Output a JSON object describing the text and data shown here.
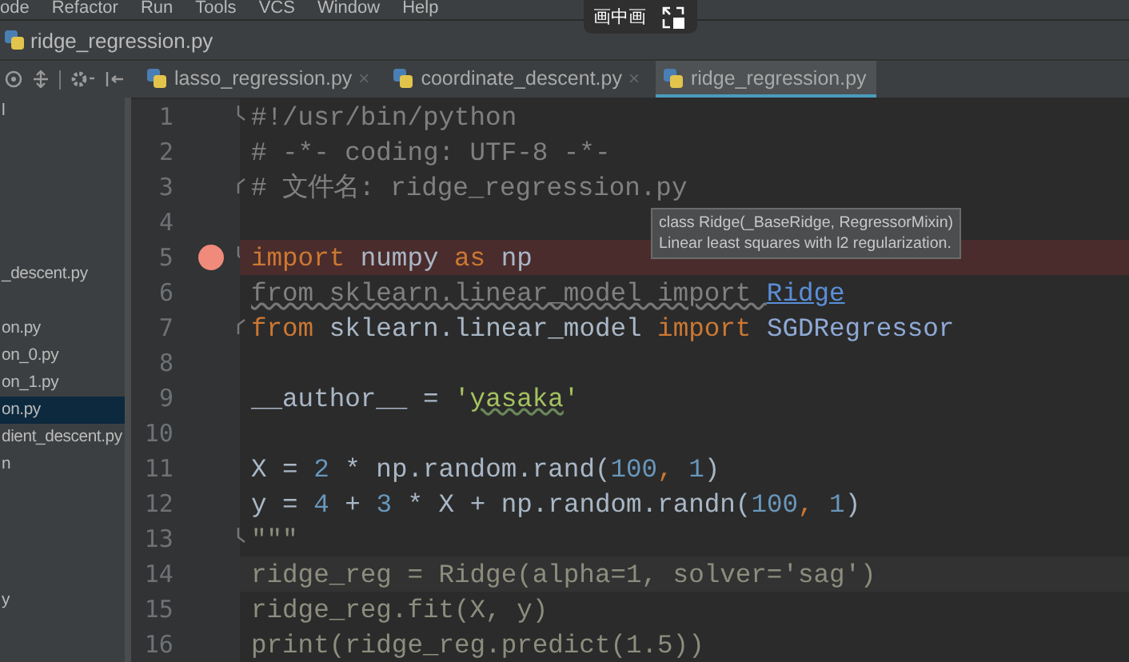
{
  "menu": [
    "ode",
    "Refactor",
    "Run",
    "Tools",
    "VCS",
    "Window",
    "Help"
  ],
  "breadcrumb": {
    "file": "ridge_regression.py"
  },
  "tabs": [
    {
      "label": "lasso_regression.py",
      "close": "×",
      "selected": false
    },
    {
      "label": "coordinate_descent.py",
      "close": "×",
      "selected": false
    },
    {
      "label": "ridge_regression.py",
      "selected": true
    }
  ],
  "project_tree": [
    {
      "text": "l",
      "selected": false
    },
    {
      "text": "_descent.py",
      "selected": false
    },
    {
      "text": "on.py",
      "selected": false
    },
    {
      "text": "on_0.py",
      "selected": false
    },
    {
      "text": "on_1.py",
      "selected": false
    },
    {
      "text": "on.py",
      "selected": true
    },
    {
      "text": "dient_descent.py",
      "selected": false
    },
    {
      "text": "n",
      "selected": false
    },
    {
      "text": "y",
      "selected": false
    }
  ],
  "code": {
    "lines": [
      {
        "number": "1",
        "fold_start": true,
        "tokens": [
          {
            "text": "#!/usr/bin/python",
            "kind": "comment"
          }
        ]
      },
      {
        "number": "2",
        "tokens": [
          {
            "text": "# -*- coding: UTF-8 -*-",
            "kind": "comment"
          }
        ]
      },
      {
        "number": "3",
        "fold_end": true,
        "tokens": [
          {
            "text": "# 文件名: ridge_regression.py",
            "kind": "comment"
          }
        ]
      },
      {
        "number": "4"
      },
      {
        "number": "5",
        "fold_start": true,
        "breakpoint": true,
        "tokens": [
          {
            "text": "import",
            "kind": "keyword"
          },
          {
            "text": " numpy ",
            "kind": "plain"
          },
          {
            "text": "as",
            "kind": "keyword"
          },
          {
            "text": " np",
            "kind": "plain"
          }
        ]
      },
      {
        "number": "6",
        "tokens": [
          {
            "text": "from sklearn.linear_model import ",
            "kind": "unused"
          },
          {
            "text": "Ridge",
            "kind": "link"
          }
        ]
      },
      {
        "number": "7",
        "fold_end": true,
        "tokens": [
          {
            "text": "from",
            "kind": "keyword"
          },
          {
            "text": " sklearn.linear_model ",
            "kind": "plain"
          },
          {
            "text": "import",
            "kind": "keyword"
          },
          {
            "text": " SGDRegressor",
            "kind": "name"
          }
        ]
      },
      {
        "number": "8"
      },
      {
        "number": "9",
        "tokens": [
          {
            "text": "__author__ = ",
            "kind": "plain"
          },
          {
            "text": "'",
            "kind": "string"
          },
          {
            "text": "yasaka",
            "kind": "typo"
          },
          {
            "text": "'",
            "kind": "string"
          }
        ]
      },
      {
        "number": "10"
      },
      {
        "number": "11",
        "tokens": [
          {
            "text": "X = ",
            "kind": "plain"
          },
          {
            "text": "2",
            "kind": "number"
          },
          {
            "text": " * np.random.rand(",
            "kind": "plain"
          },
          {
            "text": "100",
            "kind": "number"
          },
          {
            "text": ", ",
            "kind": "keyword"
          },
          {
            "text": "1",
            "kind": "number"
          },
          {
            "text": ")",
            "kind": "plain"
          }
        ]
      },
      {
        "number": "12",
        "tokens": [
          {
            "text": "y = ",
            "kind": "plain"
          },
          {
            "text": "4",
            "kind": "number"
          },
          {
            "text": " + ",
            "kind": "plain"
          },
          {
            "text": "3",
            "kind": "number"
          },
          {
            "text": " * X + np.random.randn(",
            "kind": "plain"
          },
          {
            "text": "100",
            "kind": "number"
          },
          {
            "text": ", ",
            "kind": "keyword"
          },
          {
            "text": "1",
            "kind": "number"
          },
          {
            "text": ")",
            "kind": "plain"
          }
        ]
      },
      {
        "number": "13",
        "fold_start": true,
        "tokens": [
          {
            "text": "\"\"\"",
            "kind": "doc"
          }
        ]
      },
      {
        "number": "14",
        "current": true,
        "tokens": [
          {
            "text": "ridge_reg = Ridge(alpha=1, solver='sag')",
            "kind": "doc"
          }
        ]
      },
      {
        "number": "15",
        "tokens": [
          {
            "text": "ridge_reg.fit(X, y)",
            "kind": "doc"
          }
        ]
      },
      {
        "number": "16",
        "tokens": [
          {
            "text": "print(ridge_reg.predict(1.5))",
            "kind": "doc"
          }
        ]
      }
    ]
  },
  "tooltip": {
    "lines": [
      "class Ridge(_BaseRidge, RegressorMixin)",
      "Linear least squares with l2 regularization."
    ]
  },
  "pip_overlay": {
    "label": "画中画"
  }
}
